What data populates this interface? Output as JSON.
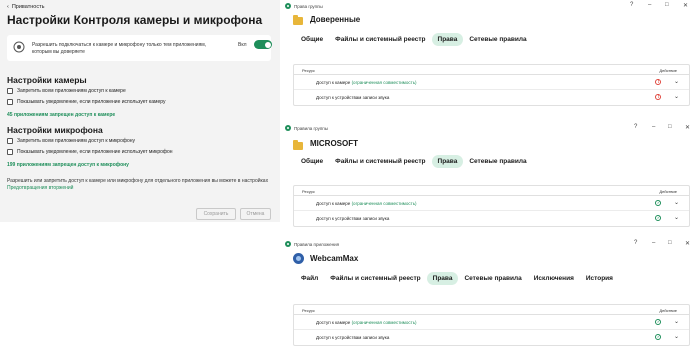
{
  "left": {
    "back_label": "Приватность",
    "title": "Настройки Контроля камеры и микрофона",
    "allow_text": "Разрешить подключаться к камере и микрофону только тем приложениям, которым вы доверяете",
    "toggle_label": "Вкл",
    "toggle_on": true,
    "camera_section": "Настройки камеры",
    "camera_checks": [
      "Запретить всем приложениям доступ к камере",
      "Показывать уведомление, если приложение использует камеру"
    ],
    "camera_blocked": "45 приложениям запрещен доступ к камере",
    "mic_section": "Настройки микрофона",
    "mic_checks": [
      "Запретить всем приложениям доступ к микрофону",
      "Показывать уведомление, если приложение использует микрофон"
    ],
    "mic_blocked": "199 приложениям запрещен доступ к микрофону",
    "note_text": "Разрешить или запретить доступ к камере или микрофону для отдельного приложения вы можете в настройках",
    "note_link": "Предотвращения вторжений",
    "save_label": "Сохранить",
    "cancel_label": "Отмена"
  },
  "dialogs": [
    {
      "window_title": "Права группы",
      "app_name": "Доверенные",
      "tabs": [
        "Общие",
        "Файлы и системный реестр",
        "Права",
        "Сетевые правила"
      ],
      "active_tab": 2,
      "col_resource": "Ресурс",
      "col_action": "Действие",
      "rows": [
        {
          "label": "Доступ к камере",
          "note": "(ограниченная совместимость)",
          "status": "blocked"
        },
        {
          "label": "Доступ к устройствам записи звука",
          "note": "",
          "status": "blocked"
        }
      ]
    },
    {
      "window_title": "Правила группы",
      "app_name": "MICROSOFT",
      "tabs": [
        "Общие",
        "Файлы и системный реестр",
        "Права",
        "Сетевые правила"
      ],
      "active_tab": 2,
      "col_resource": "Ресурс",
      "col_action": "Действие",
      "rows": [
        {
          "label": "Доступ к камере",
          "note": "(ограниченная совместимость)",
          "status": "allowed"
        },
        {
          "label": "Доступ к устройствам записи звука",
          "note": "",
          "status": "allowed"
        }
      ]
    },
    {
      "window_title": "Правила приложения",
      "app_name": "WebcamMax",
      "tabs": [
        "Файл",
        "Файлы и системный реестр",
        "Права",
        "Сетевые правила",
        "Исключения",
        "История"
      ],
      "active_tab": 2,
      "col_resource": "Ресурс",
      "col_action": "Действие",
      "rows": [
        {
          "label": "Доступ к камере",
          "note": "(ограниченная совместимость)",
          "status": "allowed"
        },
        {
          "label": "Доступ к устройствам записи звука",
          "note": "",
          "status": "allowed"
        }
      ]
    }
  ],
  "window_controls": {
    "help": "?",
    "minimize": "–",
    "maximize": "□",
    "close": "✕"
  },
  "colors": {
    "accent": "#1e8e5a",
    "tab_active": "#d7efe3",
    "blocked": "#e0463d",
    "folder": "#e8b63a"
  }
}
